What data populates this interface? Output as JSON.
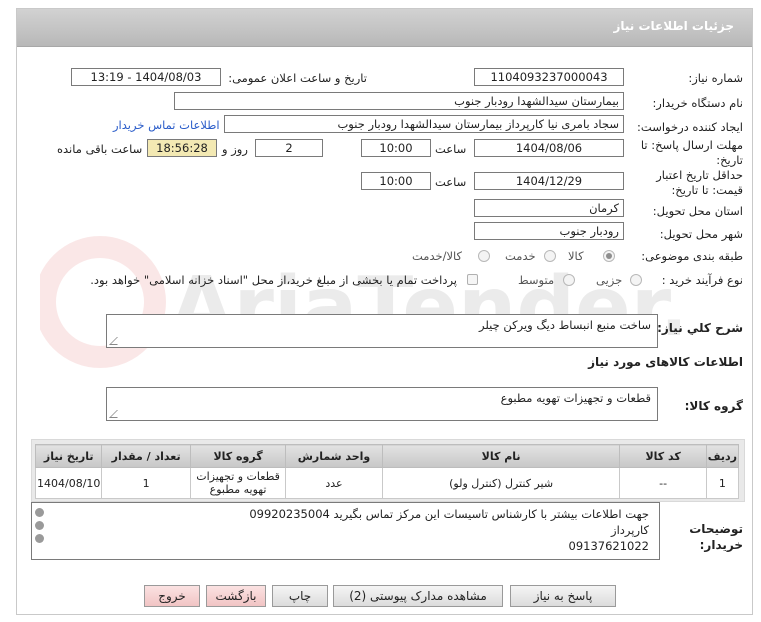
{
  "header": {
    "title": "جزئیات اطلاعات نیاز"
  },
  "form": {
    "need_number_label": "شماره نیاز:",
    "need_number": "1104093237000043",
    "announce_label": "تاریخ و ساعت اعلان عمومی:",
    "announce_value": "1404/08/03 - 13:19",
    "buyer_org_label": "نام دستگاه خریدار:",
    "buyer_org": "بیمارستان سیدالشهدا رودبار جنوب",
    "creator_label": "ایجاد کننده درخواست:",
    "creator": "سجاد بامری نیا کارپرداز بیمارستان سیدالشهدا رودبار جنوب",
    "buyer_contact_link": "اطلاعات تماس خریدار",
    "deadline_label": "مهلت ارسال پاسخ: تا تاریخ:",
    "deadline_date": "1404/08/06",
    "time_label": "ساعت",
    "deadline_time": "10:00",
    "days_value": "2",
    "day_and_label": "روز و",
    "remaining_time": "18:56:28",
    "remaining_label": "ساعت باقی مانده",
    "validity_label": "حداقل تاریخ اعتبار قیمت: تا تاریخ:",
    "validity_date": "1404/12/29",
    "validity_time_label": "ساعت",
    "validity_time": "10:00",
    "province_label": "استان محل تحویل:",
    "province": "کرمان",
    "city_label": "شهر محل تحویل:",
    "city": "رودبار جنوب",
    "category_label": "طبقه بندی موضوعی:",
    "category_options": [
      "کالا",
      "خدمت",
      "کالا/خدمت"
    ],
    "process_label": "نوع فرآیند خرید :",
    "process_options": [
      "جزیی",
      "متوسط"
    ],
    "payment_note": "پرداخت تمام یا بخشی از مبلغ خرید،از محل \"اسناد خزانه اسلامی\" خواهد بود."
  },
  "summary": {
    "label": "شرح کلي نياز:",
    "text": "ساخت منبع انبساط دیگ ویرکن چیلر"
  },
  "goods": {
    "section_title": "اطلاعات کالاهای مورد نیاز",
    "group_label": "گروه کالا:",
    "group_value": "قطعات و تجهیزات تهویه مطبوع",
    "columns": [
      "ردیف",
      "کد کالا",
      "نام کالا",
      "واحد شمارش",
      "گروه کالا",
      "تعداد / مقدار",
      "تاریخ نیاز"
    ],
    "rows": [
      [
        "1",
        "--",
        "شیر کنترل (کنترل ولو)",
        "عدد",
        "قطعات و تجهیزات تهویه مطبوع",
        "1",
        "1404/08/10"
      ]
    ]
  },
  "buyer_notes": {
    "label": "توضیحات خریدار:",
    "lines": [
      "جهت اطلاعات بیشتر با کارشناس تاسیسات این مرکز تماس بگیرید 09920235004",
      "کارپرداز",
      "09137621022"
    ]
  },
  "buttons": {
    "reply": "پاسخ به نیاز",
    "docs": "مشاهده مدارک پیوستی (2)",
    "print": "چاپ",
    "back": "بازگشت",
    "exit": "خروج"
  },
  "watermark": "AriaTender.net",
  "colors": {
    "link": "#2a5cc9",
    "header": "#c4c4c4",
    "remaining_bg": "#f3e9b3",
    "exit_bg": "#f1c4c4"
  }
}
